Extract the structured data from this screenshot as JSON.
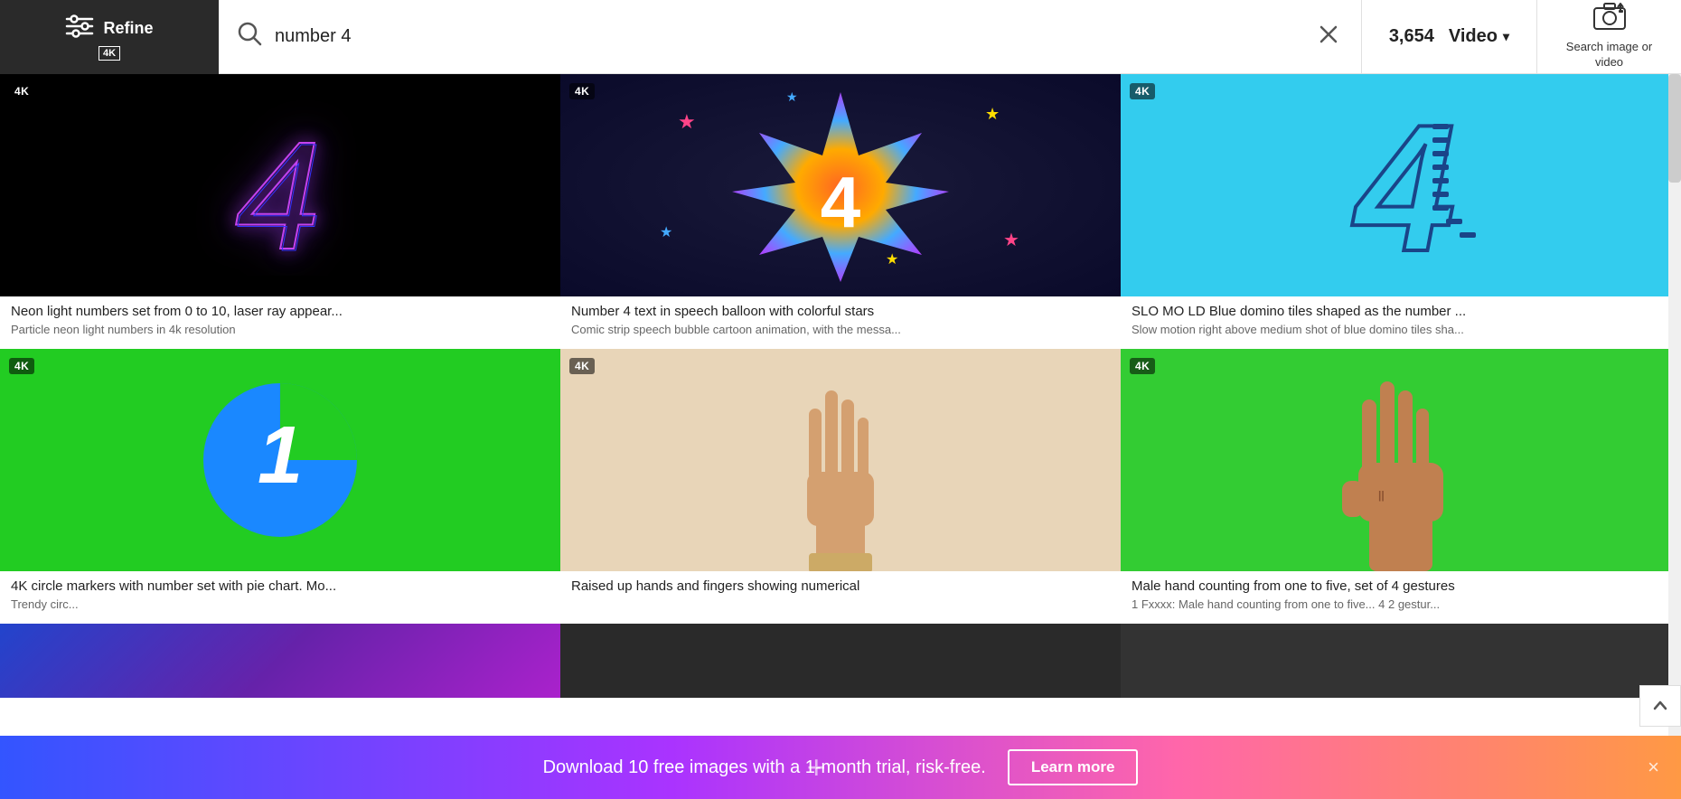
{
  "header": {
    "refine_label": "Refine",
    "refine_4k": "4K",
    "search_query": "number 4",
    "results_count": "3,654",
    "filter_label": "Video",
    "search_image_label": "Search image or video"
  },
  "grid": {
    "rows": [
      [
        {
          "badge": "4K",
          "title": "Neon light numbers set from 0 to 10, laser ray appear...",
          "subtitle": "Particle neon light numbers in 4k resolution",
          "thumb_type": "neon4"
        },
        {
          "badge": "4K",
          "title": "Number 4 text in speech balloon with colorful stars",
          "subtitle": "Comic strip speech bubble cartoon animation, with the messa...",
          "thumb_type": "starburst4"
        },
        {
          "badge": "4K",
          "title": "SLO MO LD Blue domino tiles shaped as the number ...",
          "subtitle": "Slow motion right above medium shot of blue domino tiles sha...",
          "thumb_type": "domino4"
        }
      ],
      [
        {
          "badge": "4K",
          "title": "4K circle markers with number set with pie chart. Mo...",
          "subtitle": "Trendy circ...",
          "thumb_type": "piechart"
        },
        {
          "badge": "4K",
          "title": "Raised up hands and fingers showing numerical",
          "subtitle": "",
          "thumb_type": "hand5"
        },
        {
          "badge": "4K",
          "title": "Male hand counting from one to five, set of 4 gestures",
          "subtitle": "1 Fxxxx: Male hand counting from one to five... 4 2 gestur...",
          "thumb_type": "hand4green"
        }
      ]
    ],
    "bottom_partial": [
      {
        "bg": "gradient-purple"
      },
      {
        "bg": "dark"
      },
      {
        "bg": "dark"
      }
    ]
  },
  "promo": {
    "text": "Download 10 free images with a 1-month trial, risk-free.",
    "cta": "Learn more",
    "close": "×"
  },
  "icons": {
    "search": "○",
    "clear": "✕",
    "chevron": "▾",
    "scroll_up": "⌃"
  }
}
